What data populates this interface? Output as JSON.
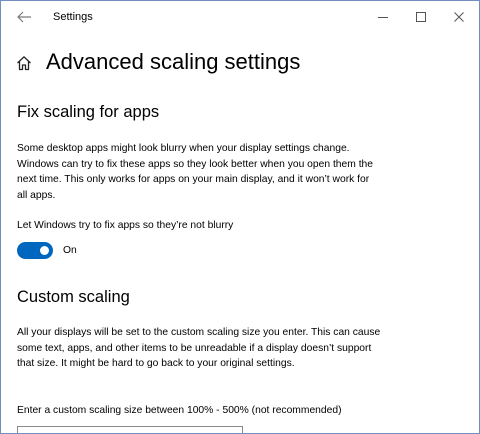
{
  "window": {
    "title": "Settings",
    "back_icon": "arrow-left-icon",
    "minimize_icon": "minimize-icon",
    "maximize_icon": "maximize-icon",
    "close_icon": "close-icon"
  },
  "header": {
    "home_icon": "home-icon",
    "title": "Advanced scaling settings"
  },
  "fix_scaling": {
    "title": "Fix scaling for apps",
    "description": "Some desktop apps might look blurry when your display settings change. Windows can try to fix these apps so they look better when you open them the next time. This only works for apps on your main display, and it won’t work for all apps.",
    "toggle_label": "Let Windows try to fix apps so they’re not blurry",
    "toggle_state": "On",
    "toggle_on": true,
    "accent": "#0067c0"
  },
  "custom_scaling": {
    "title": "Custom scaling",
    "description": "All your displays will be set to the custom scaling size you enter. This can cause some text, apps, and other items to be unreadable if a display doesn’t support that size. It might be hard to go back to your original settings.",
    "input_label": "Enter a custom scaling size between 100% - 500% (not recommended)",
    "input_value": ""
  }
}
